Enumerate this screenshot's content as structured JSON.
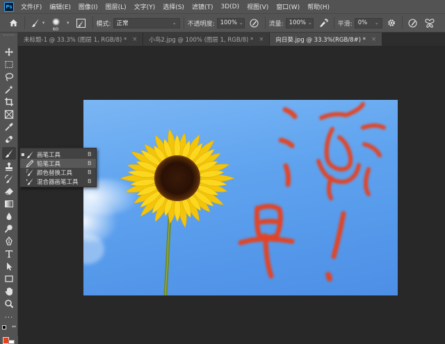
{
  "app": {
    "logo_text": "Ps"
  },
  "menu": [
    "文件(F)",
    "编辑(E)",
    "图像(I)",
    "图层(L)",
    "文字(Y)",
    "选择(S)",
    "滤镜(T)",
    "3D(D)",
    "视图(V)",
    "窗口(W)",
    "帮助(H)"
  ],
  "options": {
    "brush_size": "60",
    "mode_label": "模式:",
    "mode_value": "正常",
    "opacity_label": "不透明度:",
    "opacity_value": "100%",
    "flow_label": "流量:",
    "flow_value": "100%",
    "smoothing_label": "平滑:",
    "smoothing_value": "0%"
  },
  "tabs": [
    {
      "label": "未标题-1 @ 33.3% (图层 1, RGB/8) *",
      "close": "×",
      "active": false
    },
    {
      "label": "小鸟2.jpg @ 100% (图层 1, RGB/8) *",
      "close": "×",
      "active": false
    },
    {
      "label": "向日葵.jpg @ 33.3%(RGB/8#) *",
      "close": "×",
      "active": true
    }
  ],
  "flyout": {
    "items": [
      {
        "label": "画笔工具",
        "key": "B",
        "mark": "▪",
        "icon": "brush-icon"
      },
      {
        "label": "铅笔工具",
        "key": "B",
        "mark": "",
        "icon": "pencil-icon"
      },
      {
        "label": "颜色替换工具",
        "key": "B",
        "mark": "",
        "icon": "color-replace-icon"
      },
      {
        "label": "混合器画笔工具",
        "key": "B",
        "mark": "",
        "icon": "mixer-brush-icon"
      }
    ]
  },
  "canvas": {
    "painted_text": [
      "渶",
      "早!"
    ],
    "stroke_color": "#e8401a"
  },
  "colors": {
    "accent": "#31a8ff",
    "panel": "#535353",
    "canvas_bg": "#282828"
  }
}
